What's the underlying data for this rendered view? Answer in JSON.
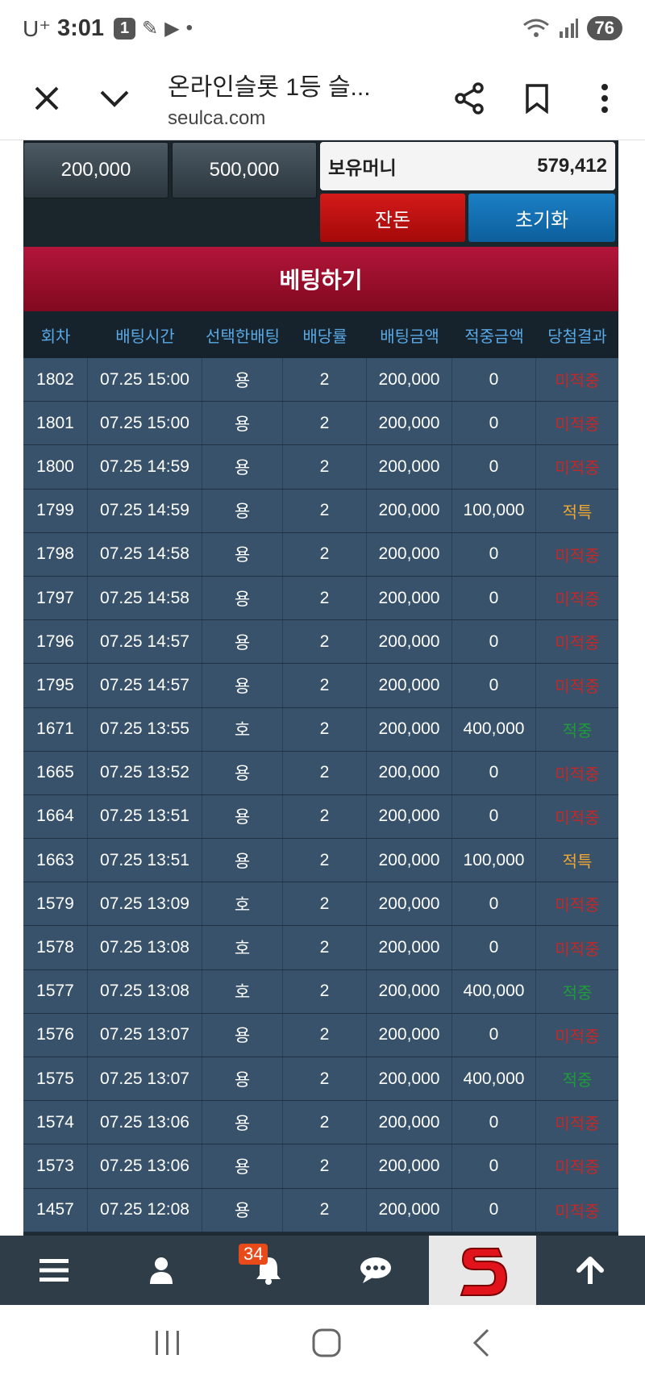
{
  "status_bar": {
    "carrier": "U⁺",
    "time": "3:01",
    "notification_count": "1",
    "battery": "76"
  },
  "browser": {
    "title": "온라인슬롯 1등 슬...",
    "url": "seulca.com"
  },
  "controls": {
    "amount_buttons": [
      "200,000",
      "500,000"
    ],
    "balance_label": "보유머니",
    "balance_value": "579,412",
    "allin_label": "잔돈",
    "reset_label": "초기화"
  },
  "bet_title": "베팅하기",
  "table": {
    "headers": [
      "회차",
      "배팅시간",
      "선택한배팅",
      "배당률",
      "배팅금액",
      "적중금액",
      "당첨결과"
    ],
    "rows": [
      {
        "round": "1802",
        "time": "07.25 15:00",
        "pick": "용",
        "odds": "2",
        "bet": "200,000",
        "win": "0",
        "result": "미적중",
        "result_color": "#c62828"
      },
      {
        "round": "1801",
        "time": "07.25 15:00",
        "pick": "용",
        "odds": "2",
        "bet": "200,000",
        "win": "0",
        "result": "미적중",
        "result_color": "#c62828"
      },
      {
        "round": "1800",
        "time": "07.25 14:59",
        "pick": "용",
        "odds": "2",
        "bet": "200,000",
        "win": "0",
        "result": "미적중",
        "result_color": "#c62828"
      },
      {
        "round": "1799",
        "time": "07.25 14:59",
        "pick": "용",
        "odds": "2",
        "bet": "200,000",
        "win": "100,000",
        "result": "적특",
        "result_color": "#f0a830"
      },
      {
        "round": "1798",
        "time": "07.25 14:58",
        "pick": "용",
        "odds": "2",
        "bet": "200,000",
        "win": "0",
        "result": "미적중",
        "result_color": "#c62828"
      },
      {
        "round": "1797",
        "time": "07.25 14:58",
        "pick": "용",
        "odds": "2",
        "bet": "200,000",
        "win": "0",
        "result": "미적중",
        "result_color": "#c62828"
      },
      {
        "round": "1796",
        "time": "07.25 14:57",
        "pick": "용",
        "odds": "2",
        "bet": "200,000",
        "win": "0",
        "result": "미적중",
        "result_color": "#c62828"
      },
      {
        "round": "1795",
        "time": "07.25 14:57",
        "pick": "용",
        "odds": "2",
        "bet": "200,000",
        "win": "0",
        "result": "미적중",
        "result_color": "#c62828"
      },
      {
        "round": "1671",
        "time": "07.25 13:55",
        "pick": "호",
        "odds": "2",
        "bet": "200,000",
        "win": "400,000",
        "result": "적중",
        "result_color": "#1e9c3a"
      },
      {
        "round": "1665",
        "time": "07.25 13:52",
        "pick": "용",
        "odds": "2",
        "bet": "200,000",
        "win": "0",
        "result": "미적중",
        "result_color": "#c62828"
      },
      {
        "round": "1664",
        "time": "07.25 13:51",
        "pick": "용",
        "odds": "2",
        "bet": "200,000",
        "win": "0",
        "result": "미적중",
        "result_color": "#c62828"
      },
      {
        "round": "1663",
        "time": "07.25 13:51",
        "pick": "용",
        "odds": "2",
        "bet": "200,000",
        "win": "100,000",
        "result": "적특",
        "result_color": "#f0a830"
      },
      {
        "round": "1579",
        "time": "07.25 13:09",
        "pick": "호",
        "odds": "2",
        "bet": "200,000",
        "win": "0",
        "result": "미적중",
        "result_color": "#c62828"
      },
      {
        "round": "1578",
        "time": "07.25 13:08",
        "pick": "호",
        "odds": "2",
        "bet": "200,000",
        "win": "0",
        "result": "미적중",
        "result_color": "#c62828"
      },
      {
        "round": "1577",
        "time": "07.25 13:08",
        "pick": "호",
        "odds": "2",
        "bet": "200,000",
        "win": "400,000",
        "result": "적중",
        "result_color": "#1e9c3a"
      },
      {
        "round": "1576",
        "time": "07.25 13:07",
        "pick": "용",
        "odds": "2",
        "bet": "200,000",
        "win": "0",
        "result": "미적중",
        "result_color": "#c62828"
      },
      {
        "round": "1575",
        "time": "07.25 13:07",
        "pick": "용",
        "odds": "2",
        "bet": "200,000",
        "win": "400,000",
        "result": "적중",
        "result_color": "#1e9c3a"
      },
      {
        "round": "1574",
        "time": "07.25 13:06",
        "pick": "용",
        "odds": "2",
        "bet": "200,000",
        "win": "0",
        "result": "미적중",
        "result_color": "#c62828"
      },
      {
        "round": "1573",
        "time": "07.25 13:06",
        "pick": "용",
        "odds": "2",
        "bet": "200,000",
        "win": "0",
        "result": "미적중",
        "result_color": "#c62828"
      },
      {
        "round": "1457",
        "time": "07.25 12:08",
        "pick": "용",
        "odds": "2",
        "bet": "200,000",
        "win": "0",
        "result": "미적중",
        "result_color": "#c62828"
      }
    ]
  },
  "bottom_nav": {
    "bell_badge": "34",
    "icons": [
      "menu-icon",
      "user-icon",
      "bell-icon",
      "chat-icon",
      "site-logo",
      "arrow-up-icon"
    ]
  },
  "system_nav": {
    "icons": [
      "recent-apps-icon",
      "home-icon",
      "back-icon"
    ]
  }
}
